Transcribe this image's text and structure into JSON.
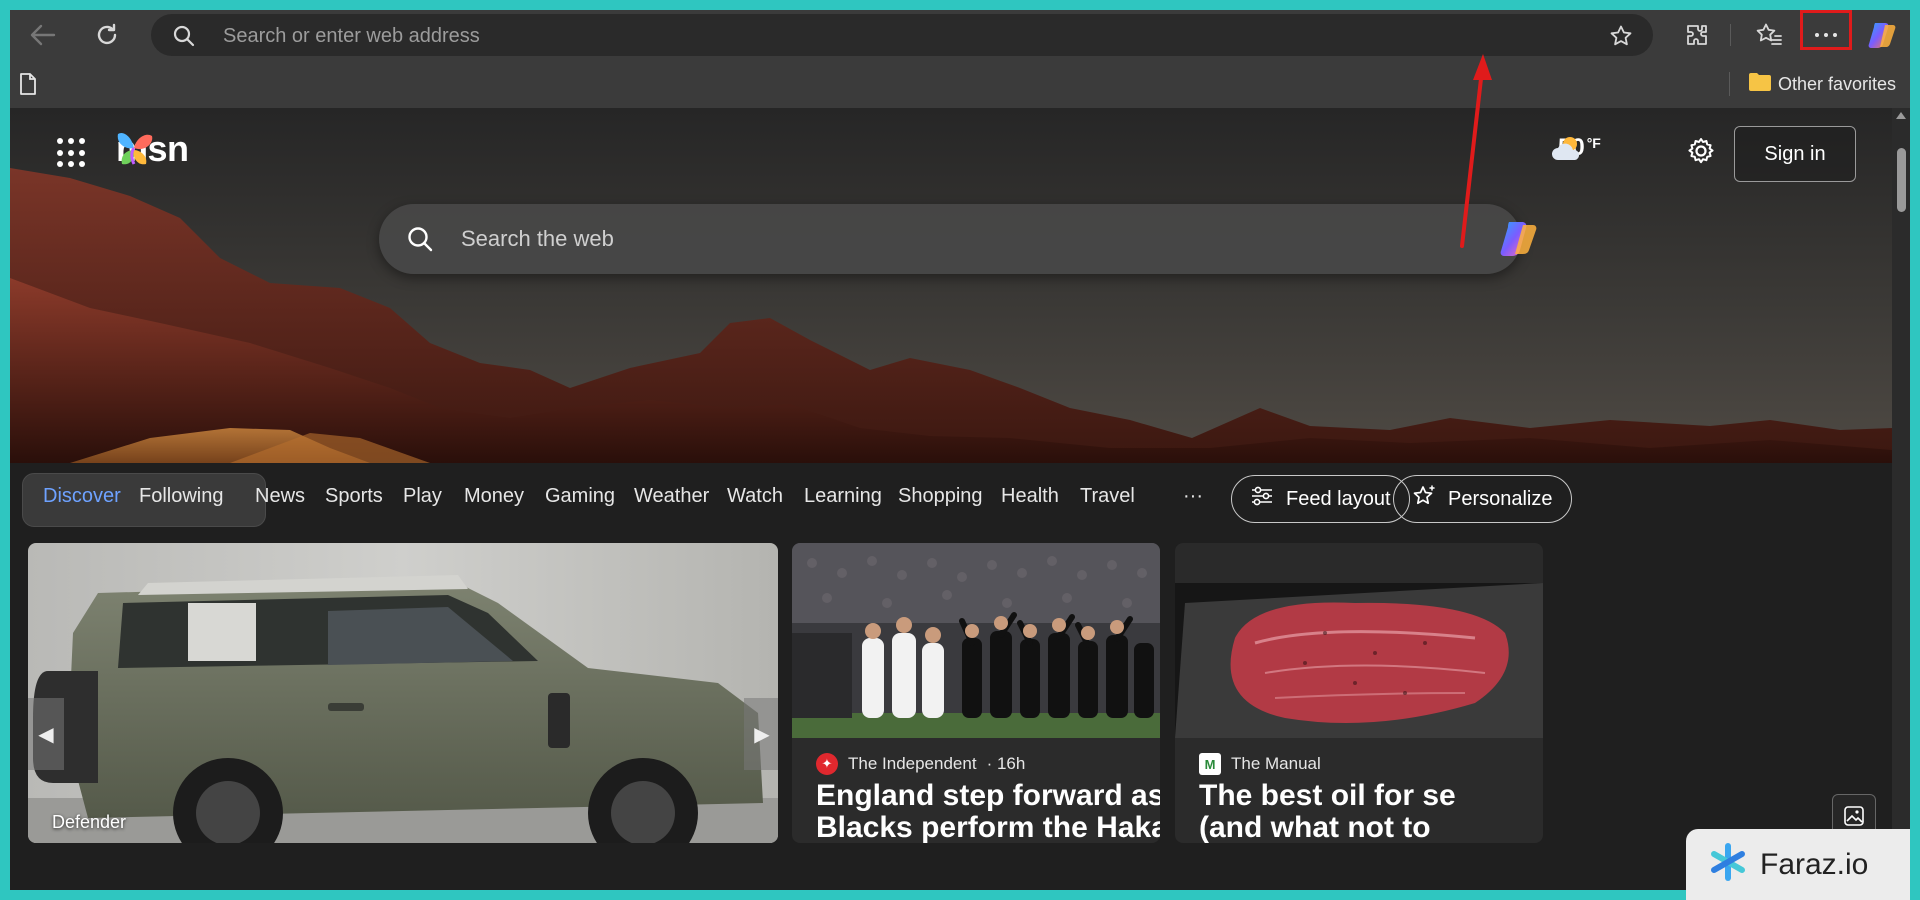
{
  "browser": {
    "address_placeholder": "Search or enter web address",
    "other_favorites": "Other favorites",
    "highlight_color": "#e01b1b"
  },
  "msn": {
    "logo_text": "msn",
    "temperature": "50",
    "temperature_unit": "°F",
    "sign_in": "Sign in",
    "search_placeholder": "Search the web"
  },
  "nav": {
    "discover": "Discover",
    "following": "Following",
    "items": [
      "News",
      "Sports",
      "Play",
      "Money",
      "Gaming",
      "Weather",
      "Watch",
      "Learning",
      "Shopping",
      "Health",
      "Travel"
    ],
    "more": "···",
    "feed_layout": "Feed layout",
    "personalize": "Personalize"
  },
  "cards": {
    "hero_caption": "Defender",
    "card2": {
      "source": "The Independent",
      "time": "· 16h",
      "title_line1": "England step forward as All",
      "title_line2": "Blacks perform the Haka"
    },
    "card3": {
      "source": "The Manual",
      "title_line1": "The best oil for se",
      "title_line2": "(and what not to"
    }
  },
  "watermark": {
    "text": "Faraz.io"
  }
}
